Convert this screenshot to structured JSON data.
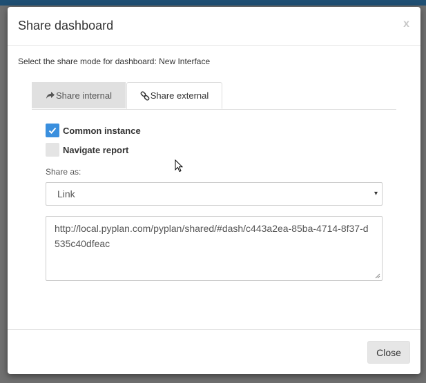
{
  "dialog": {
    "title": "Share dashboard",
    "close_x": "x",
    "description": "Select the share mode for dashboard: New Interface"
  },
  "tabs": [
    {
      "label": "Share internal",
      "icon": "share-arrow-icon",
      "active": false
    },
    {
      "label": "Share external",
      "icon": "link-icon",
      "active": true
    }
  ],
  "options": {
    "common_instance": {
      "label": "Common instance",
      "checked": true
    },
    "navigate_report": {
      "label": "Navigate report",
      "checked": false
    }
  },
  "share_as": {
    "label": "Share as:",
    "selected": "Link",
    "caret": "▾"
  },
  "url": "http://local.pyplan.com/pyplan/shared/#dash/c443a2ea-85ba-4714-8f37-d535c40dfeac",
  "footer": {
    "close_label": "Close"
  },
  "colors": {
    "checkbox_checked": "#3a8fde",
    "topbar": "#1f4f73"
  }
}
